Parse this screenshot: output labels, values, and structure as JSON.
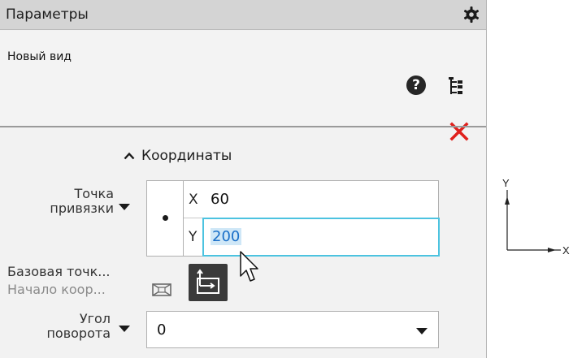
{
  "panel": {
    "title": "Параметры",
    "view_name": "Новый вид",
    "help_symbol": "?",
    "icons": [
      "gear-icon",
      "help-icon",
      "tree-icon",
      "close-icon"
    ],
    "close_color": "#e0201c"
  },
  "coords": {
    "section_label": "Координаты",
    "anchor_label": "Точка привязки",
    "x_label": "X",
    "x_value": "60",
    "y_label": "Y",
    "y_value": "200",
    "base_label": "Базовая точк...",
    "base_value": "Начало коор..."
  },
  "rotation": {
    "label": "Угол поворота",
    "value": "0"
  },
  "preview": {
    "x_axis": "X",
    "y_axis": "Y"
  },
  "colors": {
    "focus_border": "#4cc3e0",
    "selection": "#cfe7f7"
  }
}
